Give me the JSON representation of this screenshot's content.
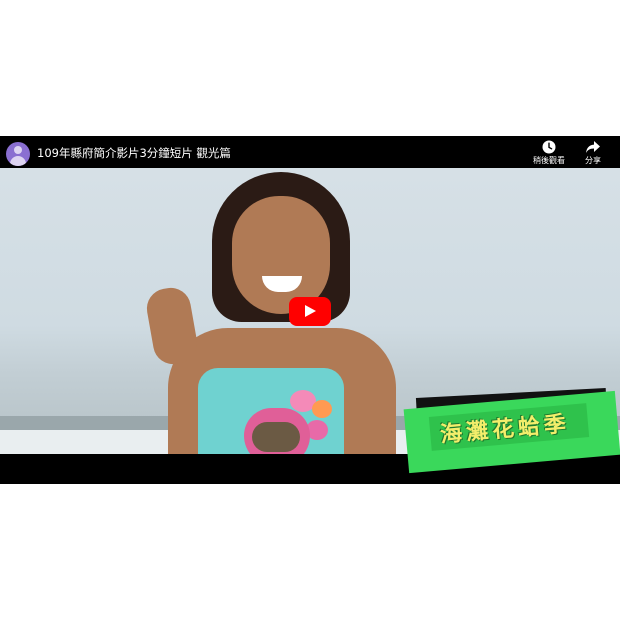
{
  "video": {
    "title": "109年縣府簡介影片3分鐘短片 觀光篇",
    "watch_later_label": "稍後觀看",
    "share_label": "分享",
    "caption_text": "海灘花蛤季"
  },
  "colors": {
    "play_button": "#ff0000",
    "caption_bg": "#3ad85b",
    "caption_text": "#f3ee6b",
    "avatar": "#8a6fd1"
  },
  "icons": [
    "avatar-icon",
    "clock-icon",
    "share-icon",
    "play-icon"
  ]
}
